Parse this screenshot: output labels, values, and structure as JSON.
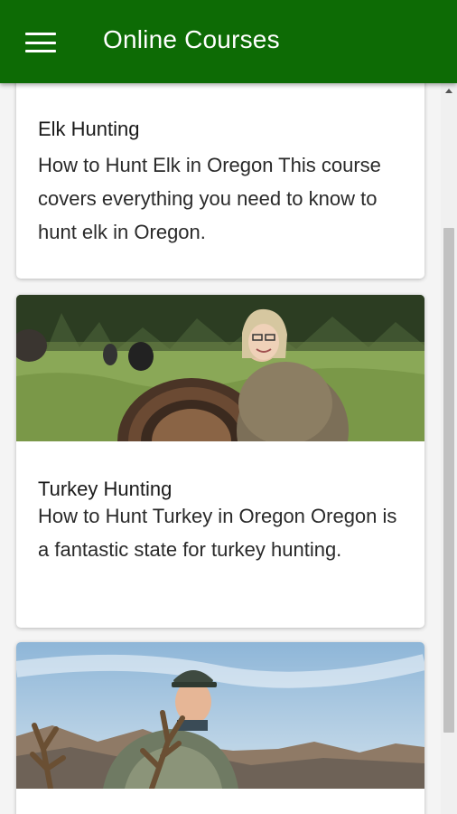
{
  "appbar": {
    "title": "Online Courses",
    "menu_icon": "hamburger-menu-icon",
    "color": "#0d6b05"
  },
  "courses": [
    {
      "title": "Elk Hunting",
      "description": "How to Hunt Elk in Oregon This course covers everything you need to know to hunt elk in Oregon."
    },
    {
      "title": "Turkey Hunting",
      "description": "How to Hunt Turkey in Oregon Oregon is a fantastic state for turkey hunting.",
      "image": "girl with turkey fan in green field"
    },
    {
      "image": "young hunter holding elk antlers with mountains"
    }
  ]
}
